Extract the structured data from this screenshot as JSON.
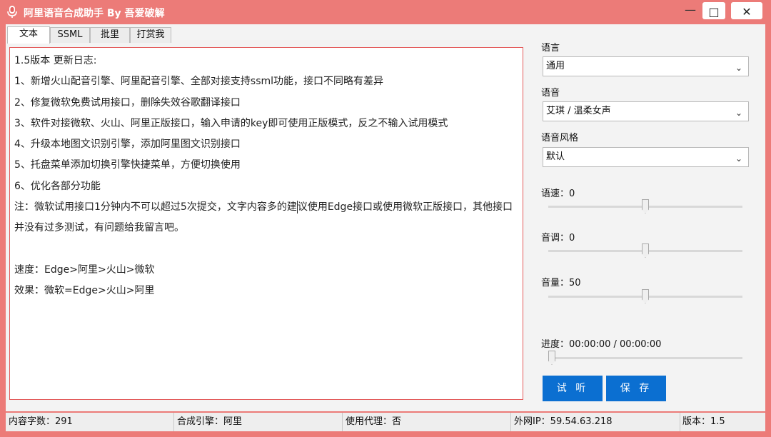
{
  "window": {
    "title": "阿里语音合成助手 By 吾爱破解",
    "controls": {
      "minimize": "—",
      "maximize": "□",
      "close": "✕"
    }
  },
  "tabs": [
    {
      "label": "文本",
      "active": true
    },
    {
      "label": "SSML",
      "active": false
    },
    {
      "label": "批里",
      "active": false
    },
    {
      "label": "打赏我",
      "active": false
    }
  ],
  "editor": {
    "lines": [
      "1.5版本 更新日志:",
      "1、新增火山配音引擎、阿里配音引擎、全部对接支持ssml功能，接口不同略有差异",
      "2、修复微软免费试用接口，删除失效谷歌翻译接口",
      "3、软件对接微软、火山、阿里正版接口，输入申请的key即可使用正版模式，反之不输入试用模式",
      "4、升级本地图文识别引擎，添加阿里图文识别接口",
      "5、托盘菜单添加切换引擎快捷菜单，方便切换使用",
      "6、优化各部分功能"
    ],
    "note_before_caret": "注：微软试用接口1分钟内不可以超过5次提交，文字内容多的建",
    "note_after_caret": "议使用Edge接口或使用微软正版接口，其他接口并没有过多测试，有问题给我留言吧。",
    "speed": "速度：Edge>阿里>火山>微软",
    "effect": "效果：微软=Edge>火山>阿里"
  },
  "panel": {
    "language_label": "语言",
    "language_value": "通用",
    "voice_label": "语音",
    "voice_value": "艾琪 / 温柔女声",
    "style_label": "语音风格",
    "style_value": "默认",
    "rate_label": "语速：0",
    "rate_value": 0,
    "pitch_label": "音调：0",
    "pitch_value": 0,
    "volume_label": "音量：50",
    "volume_value": 50,
    "progress_label": "进度：00:00:00 / 00:00:00",
    "progress_value": 0,
    "listen_button": "试 听",
    "save_button": "保 存"
  },
  "statusbar": {
    "char_count": "内容字数：291",
    "engine": "合成引擎：阿里",
    "proxy": "使用代理：否",
    "ip": "外网IP：59.54.63.218",
    "version": "版本：1.5"
  },
  "colors": {
    "accent": "#0b6fd1",
    "titlebar": "#ec7b78",
    "editor_border": "#e35a5a"
  }
}
